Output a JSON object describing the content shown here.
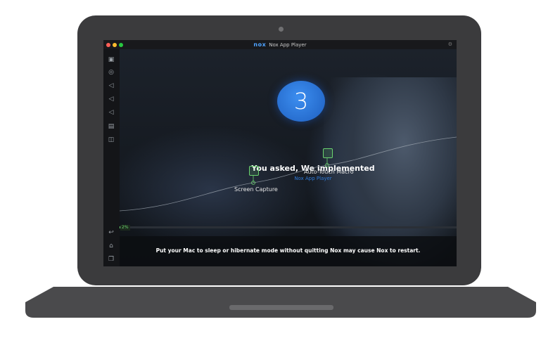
{
  "window": {
    "logo": "nox",
    "title": "Nox App Player",
    "traffic_colors": {
      "close": "#ff5f57",
      "minimize": "#febc2e",
      "zoom": "#28c840"
    }
  },
  "sidebar": {
    "items": [
      {
        "icon": "screenshot-icon"
      },
      {
        "icon": "location-icon"
      },
      {
        "icon": "volume-up-icon"
      },
      {
        "icon": "volume-down-icon"
      },
      {
        "icon": "volume-mute-icon"
      },
      {
        "icon": "apk-install-icon"
      },
      {
        "icon": "multi-window-icon"
      }
    ],
    "bottom": [
      {
        "icon": "back-icon"
      },
      {
        "icon": "home-icon"
      },
      {
        "icon": "recent-apps-icon"
      }
    ]
  },
  "splash": {
    "version_number": "3",
    "headline": "You asked, We implemented",
    "subline": "Nox App Player",
    "features": [
      {
        "label": "Screen Capture",
        "icon": "screen-capture-icon"
      },
      {
        "label": "Auto-Touch Macro",
        "icon": "macro-icon"
      }
    ]
  },
  "loading": {
    "percent_label": "2%",
    "progress": 0.02
  },
  "notice": "Put your Mac to sleep or hibernate mode without quitting Nox may cause Nox to restart.",
  "colors": {
    "accent": "#2f7ad8",
    "progress": "#6bd46f"
  }
}
